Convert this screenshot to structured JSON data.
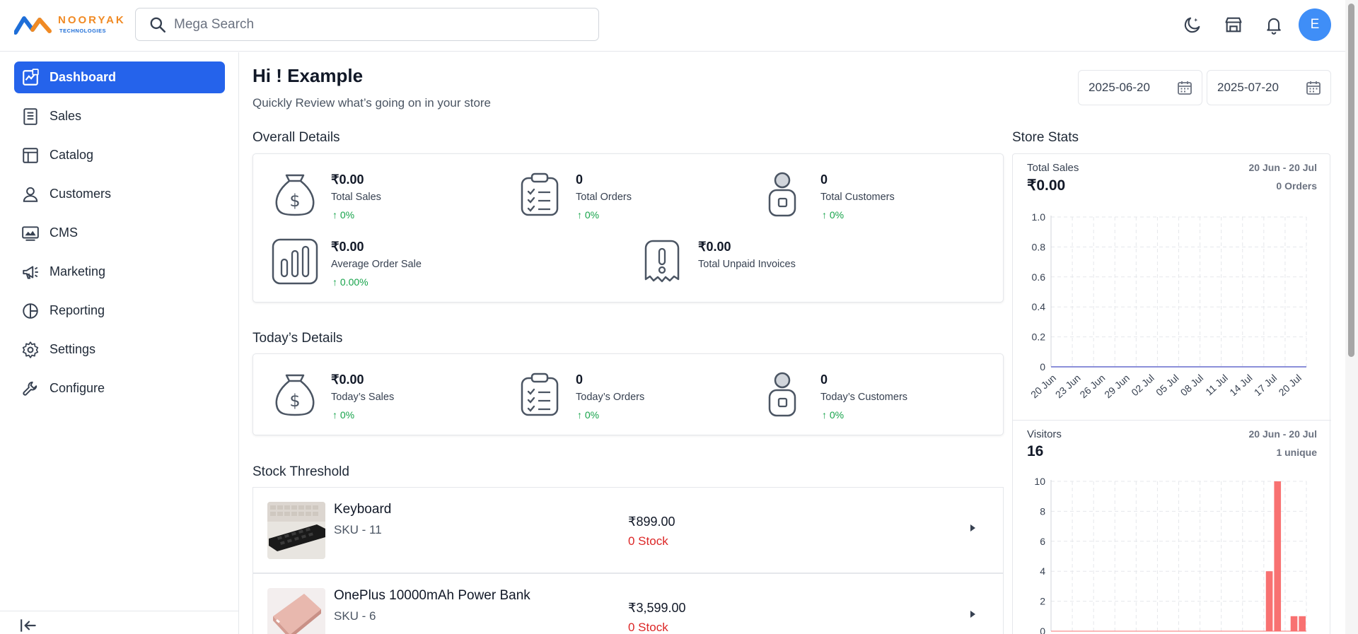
{
  "brand": {
    "name": "NOORYAK",
    "tagline": "TECHNOLOGIES",
    "colors": {
      "orange": "#f08a24",
      "blue": "#1e6ed8"
    }
  },
  "search": {
    "placeholder": "Mega Search"
  },
  "header": {
    "icons": [
      "theme-toggle-icon",
      "store-icon",
      "bell-icon"
    ],
    "avatar_initial": "E"
  },
  "sidebar": {
    "items": [
      {
        "label": "Dashboard",
        "icon": "dashboard-icon",
        "active": true
      },
      {
        "label": "Sales",
        "icon": "sales-icon"
      },
      {
        "label": "Catalog",
        "icon": "catalog-icon"
      },
      {
        "label": "Customers",
        "icon": "customers-icon"
      },
      {
        "label": "CMS",
        "icon": "cms-icon"
      },
      {
        "label": "Marketing",
        "icon": "marketing-icon"
      },
      {
        "label": "Reporting",
        "icon": "reporting-icon"
      },
      {
        "label": "Settings",
        "icon": "settings-icon"
      },
      {
        "label": "Configure",
        "icon": "configure-icon"
      }
    ],
    "accent": "#2563eb"
  },
  "main": {
    "greeting": "Hi ! Example",
    "subtitle": "Quickly Review what’s going on in your store",
    "date_from": "2025-06-20",
    "date_to": "2025-07-20"
  },
  "overall": {
    "title": "Overall Details",
    "total_sales": {
      "value": "₹0.00",
      "label": "Total Sales",
      "change": "0%"
    },
    "total_orders": {
      "value": "0",
      "label": "Total Orders",
      "change": "0%"
    },
    "total_customers": {
      "value": "0",
      "label": "Total Customers",
      "change": "0%"
    },
    "avg_order": {
      "value": "₹0.00",
      "label": "Average Order Sale",
      "change": "0.00%"
    },
    "unpaid": {
      "value": "₹0.00",
      "label": "Total Unpaid Invoices"
    }
  },
  "today": {
    "title": "Today’s Details",
    "sales": {
      "value": "₹0.00",
      "label": "Today’s Sales",
      "change": "0%"
    },
    "orders": {
      "value": "0",
      "label": "Today’s Orders",
      "change": "0%"
    },
    "customers": {
      "value": "0",
      "label": "Today’s Customers",
      "change": "0%"
    }
  },
  "stock": {
    "title": "Stock Threshold",
    "items": [
      {
        "name": "Keyboard",
        "sku": "SKU - 11",
        "price": "₹899.00",
        "stock": "0 Stock"
      },
      {
        "name": "OnePlus 10000mAh Power Bank",
        "sku": "SKU - 6",
        "price": "₹3,599.00",
        "stock": "0 Stock"
      }
    ],
    "stock_color": "#dc2626"
  },
  "store_stats": {
    "title": "Store Stats",
    "sales": {
      "title": "Total Sales",
      "value": "₹0.00",
      "range": "20 Jun - 20 Jul",
      "sub": "0 Orders"
    },
    "visitors": {
      "title": "Visitors",
      "value": "16",
      "range": "20 Jun - 20 Jul",
      "sub": "1 unique"
    }
  },
  "chart_data": [
    {
      "type": "line",
      "title": "Total Sales",
      "x_ticks": [
        "20 Jun",
        "23 Jun",
        "26 Jun",
        "29 Jun",
        "02 Jul",
        "05 Jul",
        "08 Jul",
        "11 Jul",
        "14 Jul",
        "17 Jul",
        "20 Jul"
      ],
      "y_ticks": [
        "0",
        "0.2",
        "0.4",
        "0.6",
        "0.8",
        "1.0"
      ],
      "ylim": [
        0,
        1
      ],
      "series": [
        {
          "values": [
            0,
            0,
            0,
            0,
            0,
            0,
            0,
            0,
            0,
            0,
            0,
            0,
            0,
            0,
            0,
            0,
            0,
            0,
            0,
            0,
            0,
            0,
            0,
            0,
            0,
            0,
            0,
            0,
            0,
            0,
            0
          ]
        }
      ],
      "color": "#8b8fd9",
      "grid": true
    },
    {
      "type": "bar",
      "title": "Visitors",
      "y_ticks": [
        "0",
        "2",
        "4",
        "6",
        "8",
        "10"
      ],
      "ylim": [
        0,
        10
      ],
      "values": [
        0,
        0,
        0,
        0,
        0,
        0,
        0,
        0,
        0,
        0,
        0,
        0,
        0,
        0,
        0,
        0,
        0,
        0,
        0,
        0,
        0,
        0,
        0,
        0,
        0,
        0,
        4,
        10,
        0,
        1,
        1
      ],
      "color": "#f87171",
      "grid": true
    }
  ]
}
